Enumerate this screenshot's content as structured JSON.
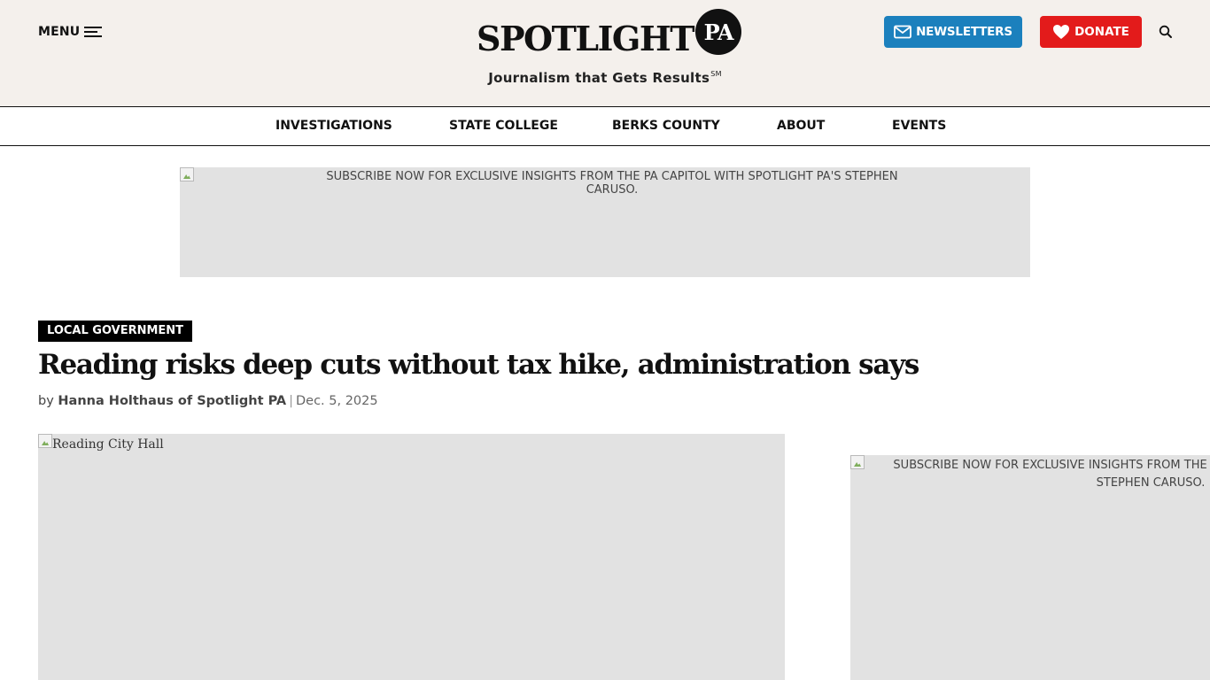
{
  "header": {
    "menu_label": "MENU",
    "logo_word": "SPOTLIGHT",
    "logo_badge": "PA",
    "tagline": "Journalism that Gets Results",
    "tagline_mark": "SM",
    "newsletters_label": "NEWSLETTERS",
    "donate_label": "DONATE",
    "colors": {
      "newsletters": "#1b80bd",
      "donate": "#e31b1b",
      "masthead_bg": "#f4f0ec"
    }
  },
  "nav": {
    "items": [
      "INVESTIGATIONS",
      "STATE COLLEGE",
      "BERKS COUNTY",
      "ABOUT",
      "EVENTS"
    ]
  },
  "ads": {
    "top_text": "SUBSCRIBE NOW FOR EXCLUSIVE INSIGHTS FROM THE PA CAPITOL WITH SPOTLIGHT PA'S STEPHEN CARUSO.",
    "side_text": "SUBSCRIBE NOW FOR EXCLUSIVE INSIGHTS FROM THE PA CAPITOL WITH SPOTLIGHT PA'S STEPHEN CARUSO."
  },
  "article": {
    "category": "LOCAL GOVERNMENT",
    "headline": "Reading risks deep cuts without tax hike, administration says",
    "byline_prefix": "by",
    "author": "Hanna Holthaus of Spotlight PA",
    "separator": "|",
    "date": "Dec. 5, 2025",
    "hero_alt": "Reading City Hall"
  }
}
